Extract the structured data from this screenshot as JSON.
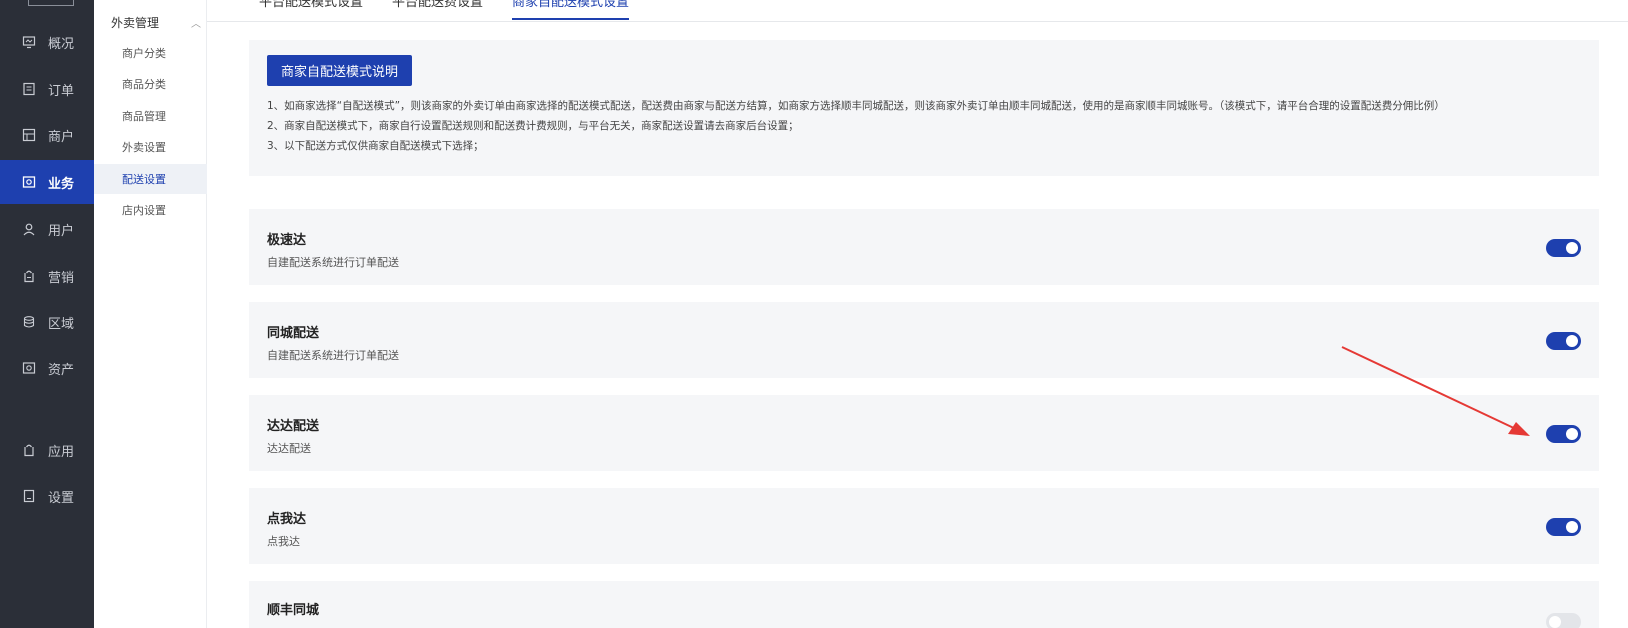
{
  "sidebar": {
    "items": [
      {
        "label": "概况",
        "icon": "monitor-icon"
      },
      {
        "label": "订单",
        "icon": "order-icon"
      },
      {
        "label": "商户",
        "icon": "shop-icon"
      },
      {
        "label": "业务",
        "icon": "business-icon",
        "active": true
      },
      {
        "label": "用户",
        "icon": "user-icon"
      },
      {
        "label": "营销",
        "icon": "marketing-icon"
      },
      {
        "label": "区域",
        "icon": "region-icon"
      },
      {
        "label": "资产",
        "icon": "asset-icon"
      },
      {
        "label": "应用",
        "icon": "app-icon"
      },
      {
        "label": "设置",
        "icon": "settings-icon"
      }
    ]
  },
  "submenu": {
    "group_title": "外卖管理",
    "items": [
      {
        "label": "商户分类"
      },
      {
        "label": "商品分类"
      },
      {
        "label": "商品管理"
      },
      {
        "label": "外卖设置"
      },
      {
        "label": "配送设置",
        "active": true
      },
      {
        "label": "店内设置"
      }
    ]
  },
  "tabs": [
    {
      "label": "平台配送模式设置"
    },
    {
      "label": "平台配送费设置"
    },
    {
      "label": "商家自配送模式设置",
      "active": true
    }
  ],
  "info": {
    "button_label": "商家自配送模式说明",
    "lines": [
      "1、如商家选择“自配送模式”，则该商家的外卖订单由商家选择的配送模式配送，配送费由商家与配送方结算，如商家方选择顺丰同城配送，则该商家外卖订单由顺丰同城配送，使用的是商家顺丰同城账号。（该模式下，请平台合理的设置配送费分佣比例）",
      "2、商家自配送模式下，商家自行设置配送规则和配送费计费规则，与平台无关，商家配送设置请去商家后台设置；",
      "3、以下配送方式仅供商家自配送模式下选择；"
    ]
  },
  "delivery_options": [
    {
      "name": "极速达",
      "desc": "自建配送系统进行订单配送",
      "enabled": true
    },
    {
      "name": "同城配送",
      "desc": "自建配送系统进行订单配送",
      "enabled": true
    },
    {
      "name": "达达配送",
      "desc": "达达配送",
      "enabled": true
    },
    {
      "name": "点我达",
      "desc": "点我达",
      "enabled": true
    },
    {
      "name": "顺丰同城",
      "desc": "",
      "enabled": false
    }
  ],
  "colors": {
    "accent": "#1e40af",
    "sidebar_bg": "#2b2f38",
    "annotation_arrow": "#e53935"
  }
}
